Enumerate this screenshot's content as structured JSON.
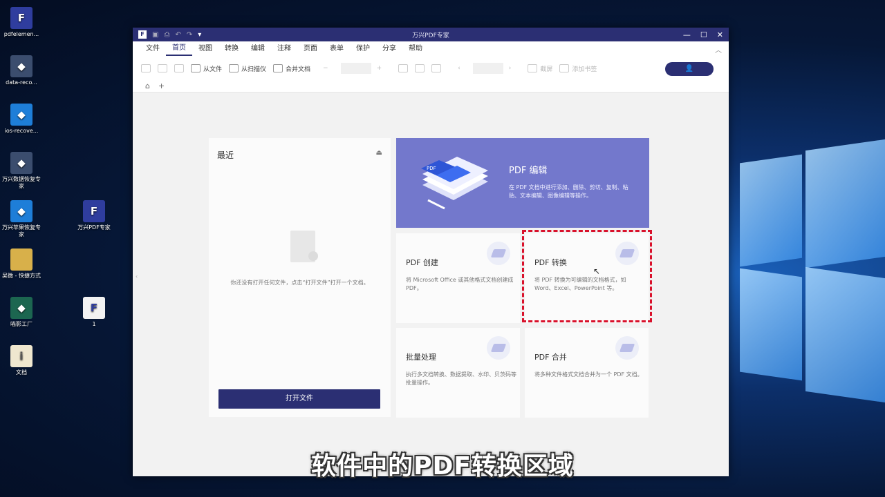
{
  "desktop": {
    "icons_left": [
      {
        "label": "pdfelemen...",
        "icon": "pdfelement-icon",
        "glyph": "F"
      },
      {
        "label": "data-reco...",
        "icon": "data-recovery-icon",
        "glyph": "◆"
      },
      {
        "label": "ios-recove...",
        "icon": "ios-recovery-icon",
        "glyph": "◆"
      },
      {
        "label": "万兴数据恢复专家",
        "icon": "wondershare-data-recovery-icon",
        "glyph": "◆"
      },
      {
        "label": "万兴苹果恢复专家",
        "icon": "wondershare-ios-recovery-icon",
        "glyph": "◆"
      },
      {
        "label": "吴微 - 快捷方式",
        "icon": "folder-shortcut-icon",
        "glyph": ""
      },
      {
        "label": "喵影工厂",
        "icon": "filmora-icon",
        "glyph": "◆"
      },
      {
        "label": "文档",
        "icon": "document-file-icon",
        "glyph": "i"
      }
    ],
    "icons_right": [
      {
        "label": "万兴PDF专家",
        "icon": "pdf-expert-icon",
        "glyph": "F"
      },
      {
        "label": "1",
        "icon": "pdf-file-icon",
        "glyph": "F"
      }
    ]
  },
  "window": {
    "title": "万兴PDF专家",
    "controls": {
      "minimize": "—",
      "maximize": "☐",
      "close": "✕"
    }
  },
  "menu": {
    "items": [
      "文件",
      "首页",
      "视图",
      "转换",
      "编辑",
      "注释",
      "页面",
      "表单",
      "保护",
      "分享",
      "帮助"
    ],
    "active": "首页"
  },
  "toolbar": {
    "from_file": "从文件",
    "from_scanner": "从扫描仪",
    "merge_docs": "合并文档",
    "screenshot": "截屏",
    "add_bookmark": "添加书签",
    "user_icon": "👤"
  },
  "tabs": {
    "home": "⌂",
    "add": "+"
  },
  "recent": {
    "title": "最近",
    "empty_text": "你还没有打开任何文件，点击“打开文件”打开一个文档。",
    "open_button": "打开文件"
  },
  "hero": {
    "title": "PDF 编辑",
    "desc": "在 PDF 文档中进行添加、删除、剪切、复制、粘贴、文本编辑、图像编辑等操作。"
  },
  "cards": [
    {
      "title": "PDF 创建",
      "desc": "将 Microsoft Office 或其他格式文档创建成 PDF。"
    },
    {
      "title": "PDF 转换",
      "desc": "将 PDF 转换为可编辑的文档格式，如 Word、Excel、PowerPoint 等。"
    },
    {
      "title": "批量处理",
      "desc": "执行多文档转换、数据提取、水印、贝茨码等批量操作。"
    },
    {
      "title": "PDF 合并",
      "desc": "将多种文件格式文档合并为一个 PDF 文档。"
    }
  ],
  "subtitle": "软件中的PDF转换区域",
  "colors": {
    "primary": "#2b2f73",
    "hero": "#7378cc",
    "highlight": "#d9112b"
  }
}
